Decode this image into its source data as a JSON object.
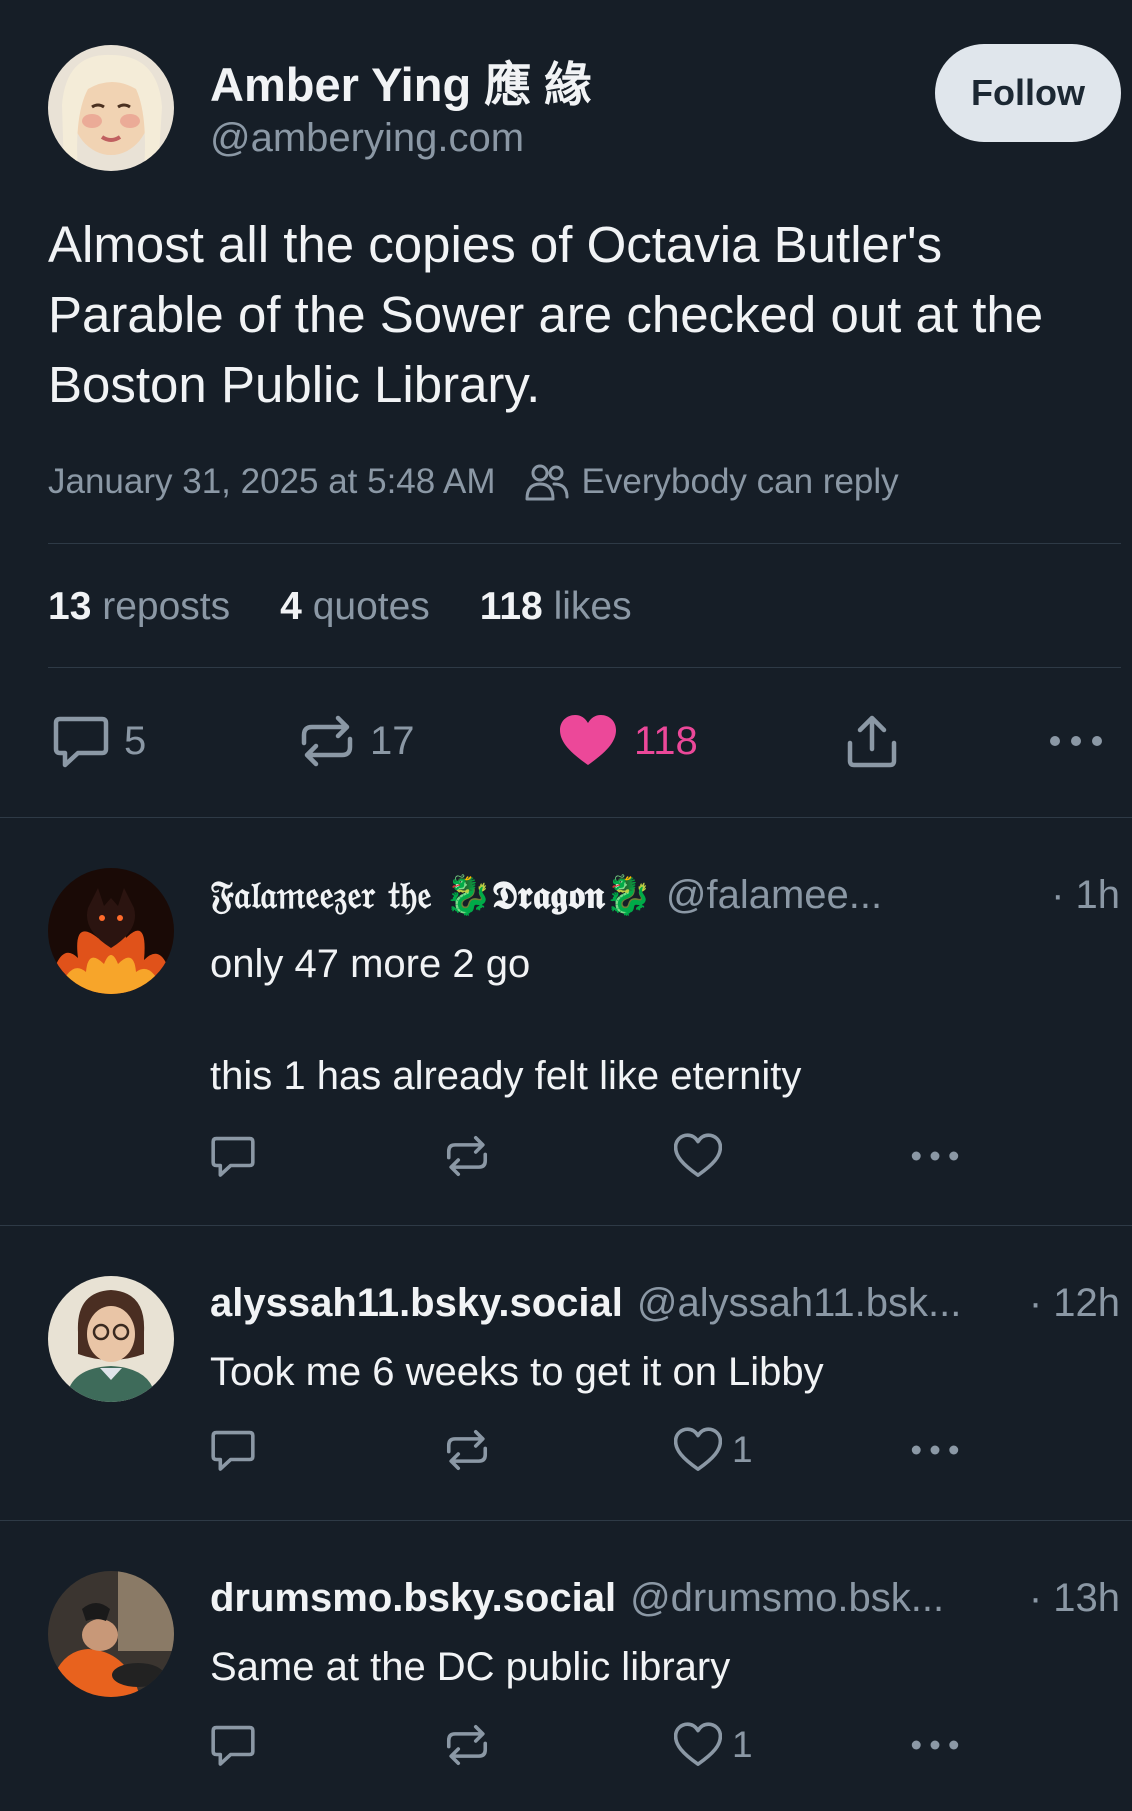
{
  "post": {
    "author_name": "Amber Ying 應 緣",
    "author_handle": "@amberying.com",
    "follow_label": "Follow",
    "text": "Almost all the copies of Octavia Butler's Parable of the Sower are checked out at the Boston Public Library.",
    "timestamp": "January 31, 2025 at 5:48 AM",
    "reply_setting": "Everybody can reply",
    "stats": {
      "reposts_count": "13",
      "reposts_label": "reposts",
      "quotes_count": "4",
      "quotes_label": "quotes",
      "likes_count": "118",
      "likes_label": "likes"
    },
    "actions": {
      "replies": "5",
      "reposts": "17",
      "likes": "118",
      "liked": true
    }
  },
  "replies": [
    {
      "name": "𝔉𝔞𝔩𝔞𝔪𝔢𝔢𝔷𝔢𝔯 𝔱𝔥𝔢 🐉𝕯𝖗𝖆𝖌𝖔𝖓🐉",
      "handle": "@falamee...",
      "time": "· 1h",
      "text": "only 47 more 2 go\n\nthis 1 has already felt like eternity",
      "likes": ""
    },
    {
      "name": "alyssah11.bsky.social",
      "handle": "@alyssah11.bsk...",
      "time": "· 12h",
      "text": "Took me 6 weeks to get it on Libby",
      "likes": "1"
    },
    {
      "name": "drumsmo.bsky.social",
      "handle": "@drumsmo.bsk...",
      "time": "· 13h",
      "text": "Same at the DC public library",
      "likes": "1"
    }
  ],
  "colors": {
    "background": "#161e27",
    "text": "#f1f3f5",
    "muted": "#8b98a5",
    "like_pink": "#ec4899",
    "divider": "#2e3a46"
  }
}
